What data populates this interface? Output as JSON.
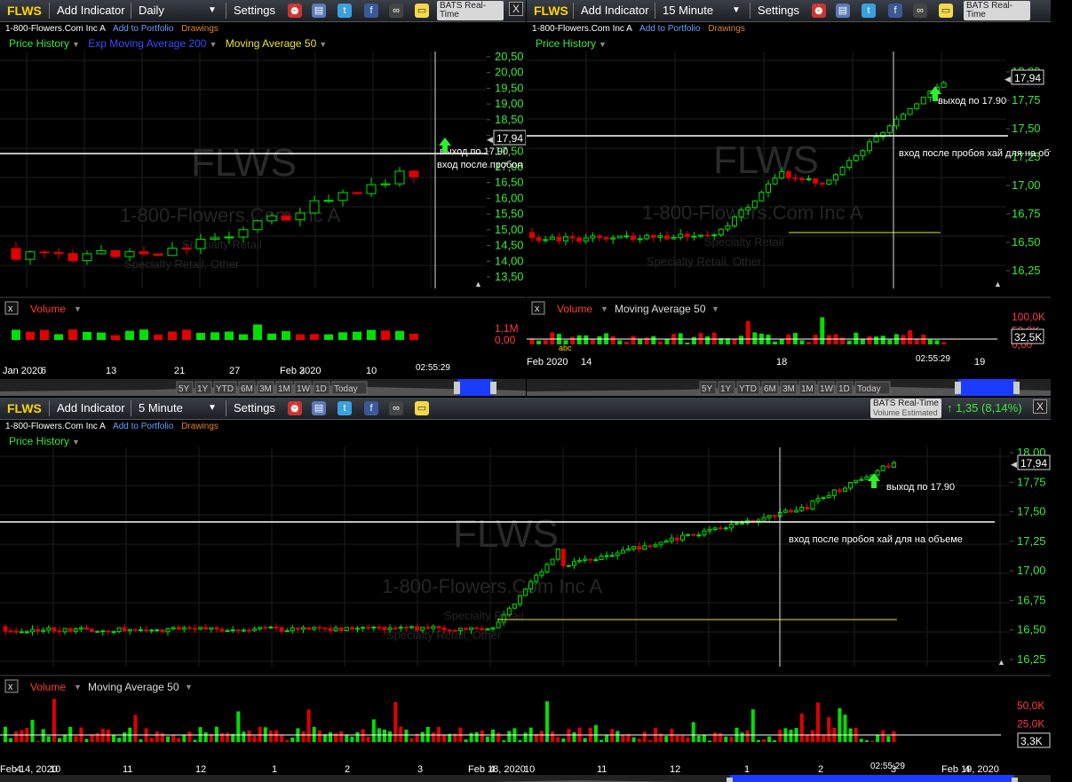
{
  "toolbar": {
    "add_indicator": "Add Indicator",
    "settings": "Settings",
    "dropdown_arrow": "▼",
    "bats_title": "BATS Real-Time",
    "bats_sub": "Volume Estimated",
    "close": "X"
  },
  "icons": [
    "alarm-clock-icon",
    "database-icon",
    "twitter-icon",
    "facebook-icon",
    "binoculars-icon",
    "sticky-note-icon"
  ],
  "company": {
    "symbol": "FLWS",
    "name": "1-800-Flowers.Com Inc A",
    "add_portfolio": "Add to Portfolio",
    "drawings": "Drawings",
    "watermark_name": "1-800-Flowers.Com Inc A",
    "sector": "Specialty Retail",
    "industry": "Specialty Retail, Other"
  },
  "colors": {
    "up": "#00e000",
    "down": "#e00000",
    "price_green": "#3ce83c",
    "label_red": "#ff3b3b",
    "hline": "#ffffff",
    "ma": "#e8e040",
    "ema": "#2020e0"
  },
  "nav_ranges": [
    "5Y",
    "1Y",
    "YTD",
    "6M",
    "3M",
    "1M",
    "1W",
    "1D",
    "Today"
  ],
  "panels": [
    {
      "id": "daily",
      "interval": "Daily",
      "legend": [
        {
          "label": "Price History",
          "color": "#3ce83c"
        },
        {
          "label": "Exp Moving Average 200",
          "color": "#3a4cff"
        },
        {
          "label": "Moving Average 50",
          "color": "#e8e040"
        }
      ],
      "price_axis": [
        "20,50",
        "20,00",
        "19,50",
        "19,00",
        "18,50",
        "18,00",
        "17,50",
        "17,00",
        "16,50",
        "16,00",
        "15,50",
        "15,00",
        "14,50",
        "14,00",
        "13,50"
      ],
      "price_tag": "17,94",
      "annotations": [
        "выход по 17.90",
        "вход    после пробоя хай для на объеме"
      ],
      "volume_label": "Volume",
      "volume_axis": [
        "1,1M",
        "0,00"
      ],
      "x_labels": [
        "Jan 2020",
        "6",
        "13",
        "21",
        "27",
        "3",
        "Feb 2020",
        "10"
      ],
      "time": "02:55:29"
    },
    {
      "id": "m15",
      "interval": "15 Minute",
      "legend": [
        {
          "label": "Price History",
          "color": "#3ce83c"
        }
      ],
      "price_axis": [
        "18,00",
        "17,75",
        "17,50",
        "17,25",
        "17,00",
        "16,75",
        "16,50",
        "16,25"
      ],
      "price_tag": "17,94",
      "annotations": [
        "выход по 17.90",
        "вход    после пробоя хай для на объеме"
      ],
      "volume_label": "Volume",
      "volume_ma": "Moving Average 50",
      "volume_axis": [
        "100,0K",
        "50,0K",
        "0,00"
      ],
      "volume_tag": "32,5K",
      "x_labels": [
        "Feb 2020",
        "14",
        "18",
        "19"
      ],
      "time": "02:55:29",
      "volume_marker": "abc"
    },
    {
      "id": "m5",
      "interval": "5 Minute",
      "legend": [
        {
          "label": "Price History",
          "color": "#3ce83c"
        }
      ],
      "price_axis": [
        "18,00",
        "17,75",
        "17,50",
        "17,25",
        "17,00",
        "16,75",
        "16,50",
        "16,25"
      ],
      "price_tag": "17,94",
      "annotations": [
        "выход по 17.90",
        "вход    после пробоя хай для на объеме"
      ],
      "change": "↑ 1,35 (8,14%)",
      "volume_label": "Volume",
      "volume_ma": "Moving Average 50",
      "volume_axis": [
        "50,0K",
        "25,0K",
        "0,00"
      ],
      "volume_tag": "3,3K",
      "x_labels": [
        "Feb 14, 2020",
        "4",
        "10",
        "11",
        "12",
        "1",
        "2",
        "3",
        "4",
        "Feb 18, 2020",
        "10",
        "11",
        "12",
        "1",
        "2",
        "3",
        "4",
        "Feb 19, 2020"
      ],
      "time": "02:55:29"
    }
  ]
}
